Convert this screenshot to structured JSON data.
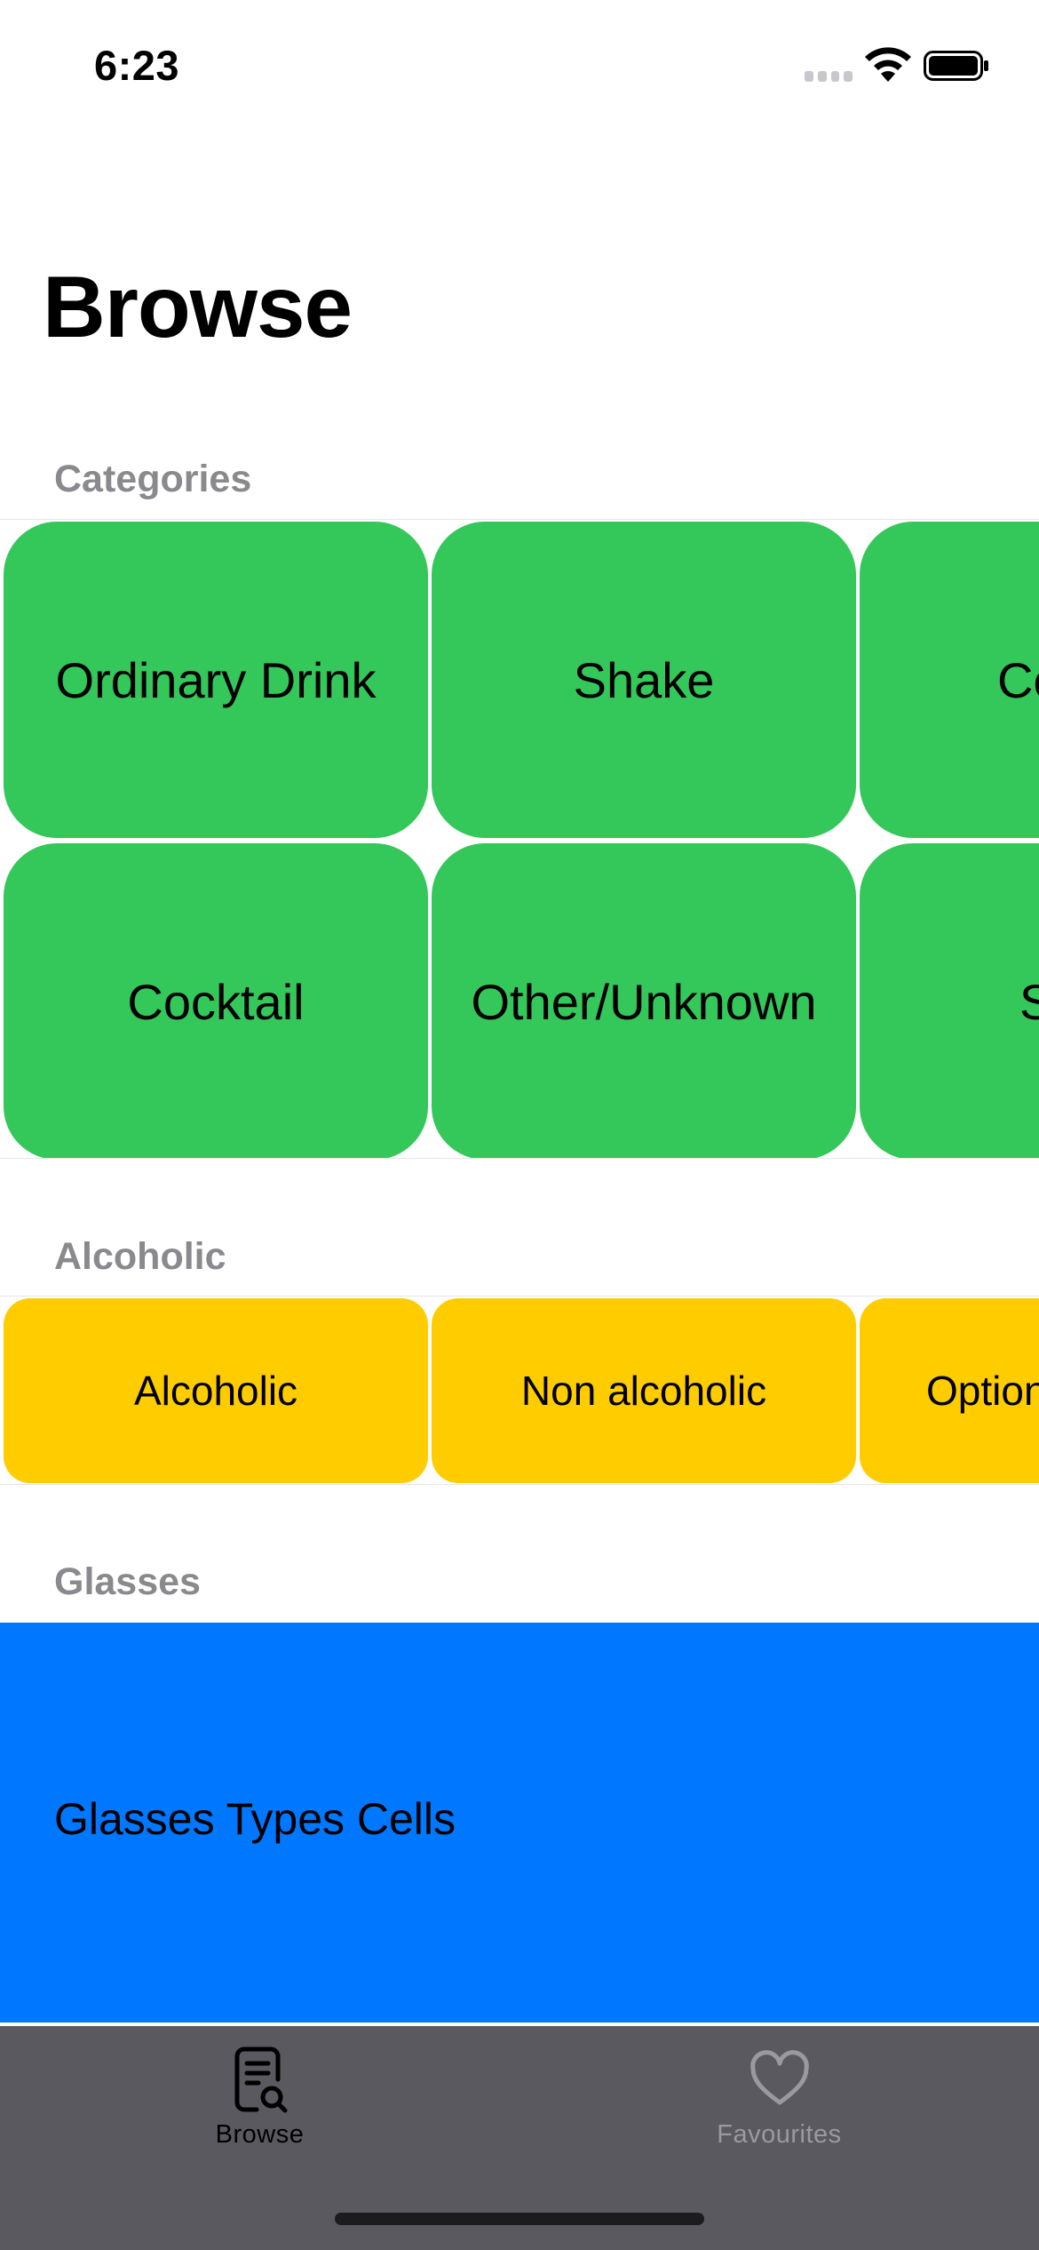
{
  "status_bar": {
    "time": "6:23"
  },
  "page": {
    "title": "Browse"
  },
  "sections": {
    "categories": {
      "header": "Categories",
      "row1": [
        "Ordinary Drink",
        "Shake",
        "Co"
      ],
      "row2": [
        "Cocktail",
        "Other/Unknown",
        "S"
      ]
    },
    "alcoholic": {
      "header": "Alcoholic",
      "items": [
        "Alcoholic",
        "Non alcoholic",
        "Option"
      ]
    },
    "glasses": {
      "header": "Glasses",
      "cell_label": "Glasses Types Cells"
    }
  },
  "tab_bar": {
    "tabs": [
      {
        "label": "Browse",
        "icon": "browse-document-search-icon",
        "selected": true
      },
      {
        "label": "Favourites",
        "icon": "heart-icon",
        "selected": false
      }
    ]
  },
  "colors": {
    "category_cell": "#34c759",
    "alcoholic_cell": "#ffcc00",
    "glasses_band": "#0077ff",
    "tab_bar": "#59595f",
    "section_header": "#8a8a8e",
    "tab_selected": "#000000",
    "tab_unselected": "#9a9a9e"
  }
}
